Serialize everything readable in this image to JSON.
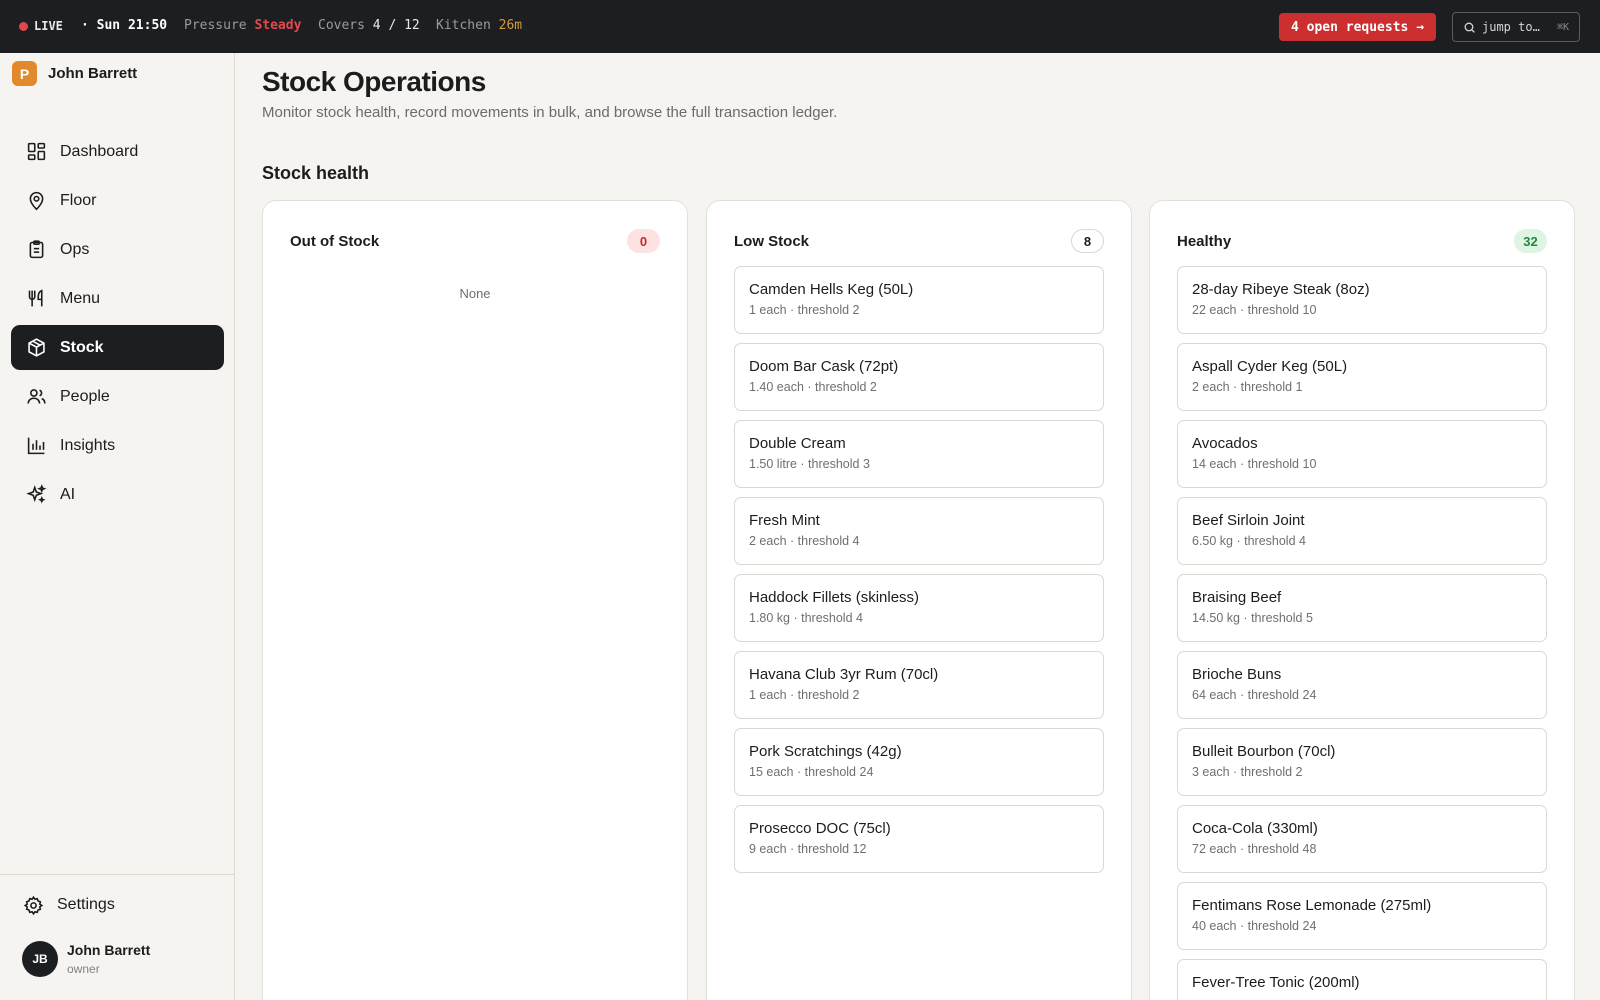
{
  "topbar": {
    "live": "LIVE",
    "time": "· Sun 21:50",
    "pressure_label": "Pressure",
    "pressure_value": "Steady",
    "covers_label": "Covers",
    "covers_value": "4 / 12",
    "kitchen_label": "Kitchen",
    "kitchen_value": "26m",
    "requests_button": "4 open requests →",
    "jump_placeholder": "jump to…",
    "jump_shortcut": "⌘K"
  },
  "brand": {
    "logo_letter": "P",
    "name": "John Barrett"
  },
  "nav": [
    {
      "label": "Dashboard",
      "icon": "dashboard-icon"
    },
    {
      "label": "Floor",
      "icon": "map-pin-icon"
    },
    {
      "label": "Ops",
      "icon": "clipboard-icon"
    },
    {
      "label": "Menu",
      "icon": "utensils-icon"
    },
    {
      "label": "Stock",
      "icon": "package-icon",
      "active": true
    },
    {
      "label": "People",
      "icon": "users-icon"
    },
    {
      "label": "Insights",
      "icon": "bar-chart-icon"
    },
    {
      "label": "AI",
      "icon": "sparkles-icon"
    }
  ],
  "settings_label": "Settings",
  "user": {
    "initials": "JB",
    "name": "John Barrett",
    "role": "owner"
  },
  "page": {
    "title": "Stock Operations",
    "subtitle": "Monitor stock health, record movements in bulk, and browse the full transaction ledger.",
    "section_title": "Stock health"
  },
  "columns": {
    "out": {
      "title": "Out of Stock",
      "count": "0",
      "empty_text": "None",
      "color": "#c8252b"
    },
    "low": {
      "title": "Low Stock",
      "count": "8",
      "items": [
        {
          "name": "Camden Hells Keg (50L)",
          "meta": "1 each · threshold 2"
        },
        {
          "name": "Doom Bar Cask (72pt)",
          "meta": "1.40 each · threshold 2"
        },
        {
          "name": "Double Cream",
          "meta": "1.50 litre · threshold 3"
        },
        {
          "name": "Fresh Mint",
          "meta": "2 each · threshold 4"
        },
        {
          "name": "Haddock Fillets (skinless)",
          "meta": "1.80 kg · threshold 4"
        },
        {
          "name": "Havana Club 3yr Rum (70cl)",
          "meta": "1 each · threshold 2"
        },
        {
          "name": "Pork Scratchings (42g)",
          "meta": "15 each · threshold 24"
        },
        {
          "name": "Prosecco DOC (75cl)",
          "meta": "9 each · threshold 12"
        }
      ]
    },
    "healthy": {
      "title": "Healthy",
      "count": "32",
      "color": "#1f8a3b",
      "items": [
        {
          "name": "28-day Ribeye Steak (8oz)",
          "meta": "22 each · threshold 10"
        },
        {
          "name": "Aspall Cyder Keg (50L)",
          "meta": "2 each · threshold 1"
        },
        {
          "name": "Avocados",
          "meta": "14 each · threshold 10"
        },
        {
          "name": "Beef Sirloin Joint",
          "meta": "6.50 kg · threshold 4"
        },
        {
          "name": "Braising Beef",
          "meta": "14.50 kg · threshold 5"
        },
        {
          "name": "Brioche Buns",
          "meta": "64 each · threshold 24"
        },
        {
          "name": "Bulleit Bourbon (70cl)",
          "meta": "3 each · threshold 2"
        },
        {
          "name": "Coca-Cola (330ml)",
          "meta": "72 each · threshold 48"
        },
        {
          "name": "Fentimans Rose Lemonade (275ml)",
          "meta": "40 each · threshold 24"
        },
        {
          "name": "Fever-Tree Tonic (200ml)",
          "meta": ""
        }
      ]
    }
  },
  "colors": {
    "accent_red": "#cc2f30",
    "brand_orange": "#e28a2b",
    "dark": "#1d1e21"
  }
}
